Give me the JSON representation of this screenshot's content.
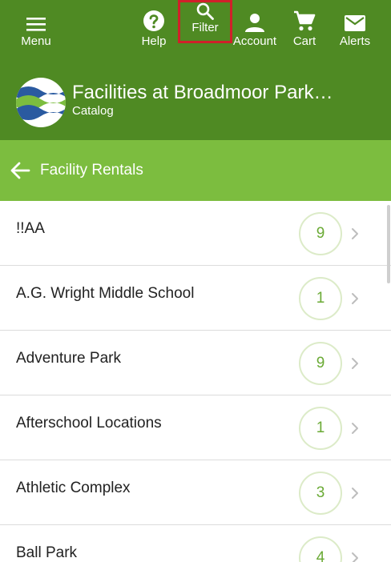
{
  "nav": {
    "menu": "Menu",
    "help": "Help",
    "filter": "Filter",
    "account": "Account",
    "cart": "Cart",
    "alerts": "Alerts"
  },
  "header": {
    "title": "Facilities at Broadmoor Park…",
    "subtitle": "Catalog"
  },
  "section": {
    "title": "Facility Rentals"
  },
  "items": [
    {
      "label": "!!AA",
      "count": "9"
    },
    {
      "label": "A.G. Wright Middle School",
      "count": "1"
    },
    {
      "label": "Adventure Park",
      "count": "9"
    },
    {
      "label": "Afterschool Locations",
      "count": "1"
    },
    {
      "label": "Athletic Complex",
      "count": "3"
    },
    {
      "label": "Ball Park",
      "count": "4"
    }
  ],
  "colors": {
    "nav_bg": "#4f8a23",
    "section_bg": "#7cbd3f",
    "badge_text": "#6aaa35",
    "highlight": "#d0202a"
  }
}
